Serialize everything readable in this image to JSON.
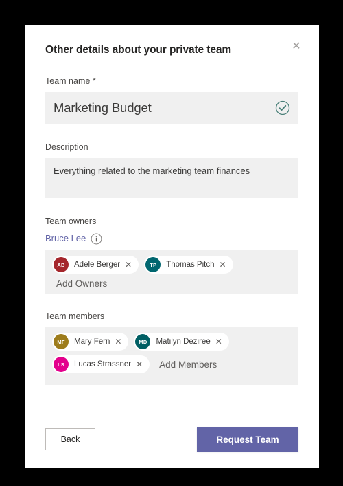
{
  "dialog": {
    "title": "Other details about your private team",
    "close_label": "✕",
    "close_icon": "close-icon"
  },
  "team_name": {
    "label": "Team name *",
    "value": "Marketing Budget",
    "placeholder": "Enter team name",
    "validation_icon": "check-circle-icon",
    "validation_color": "#4a8079"
  },
  "description": {
    "label": "Description",
    "value": "Everything related to the marketing team finances",
    "placeholder": "Enter a description"
  },
  "owners": {
    "label": "Team owners",
    "primary_owner": "Bruce Lee",
    "primary_owner_color": "#6264a7",
    "info_icon": "info-icon",
    "add_placeholder": "Add Owners",
    "people": [
      {
        "initials": "AB",
        "name": "Adele Berger",
        "color": "#a4262c",
        "remove_label": "✕"
      },
      {
        "initials": "TP",
        "name": "Thomas Pitch",
        "color": "#00666f",
        "remove_label": "✕"
      }
    ]
  },
  "members": {
    "label": "Team members",
    "add_placeholder": "Add Members",
    "people": [
      {
        "initials": "MF",
        "name": "Mary Fern",
        "color": "#9d7c1c",
        "remove_label": "✕"
      },
      {
        "initials": "MD",
        "name": "Matilyn Deziree",
        "color": "#005e63",
        "remove_label": "✕"
      },
      {
        "initials": "LS",
        "name": "Lucas Strassner",
        "color": "#e3008c",
        "remove_label": "✕"
      }
    ]
  },
  "footer": {
    "back_label": "Back",
    "submit_label": "Request Team",
    "submit_color": "#6264a7"
  }
}
